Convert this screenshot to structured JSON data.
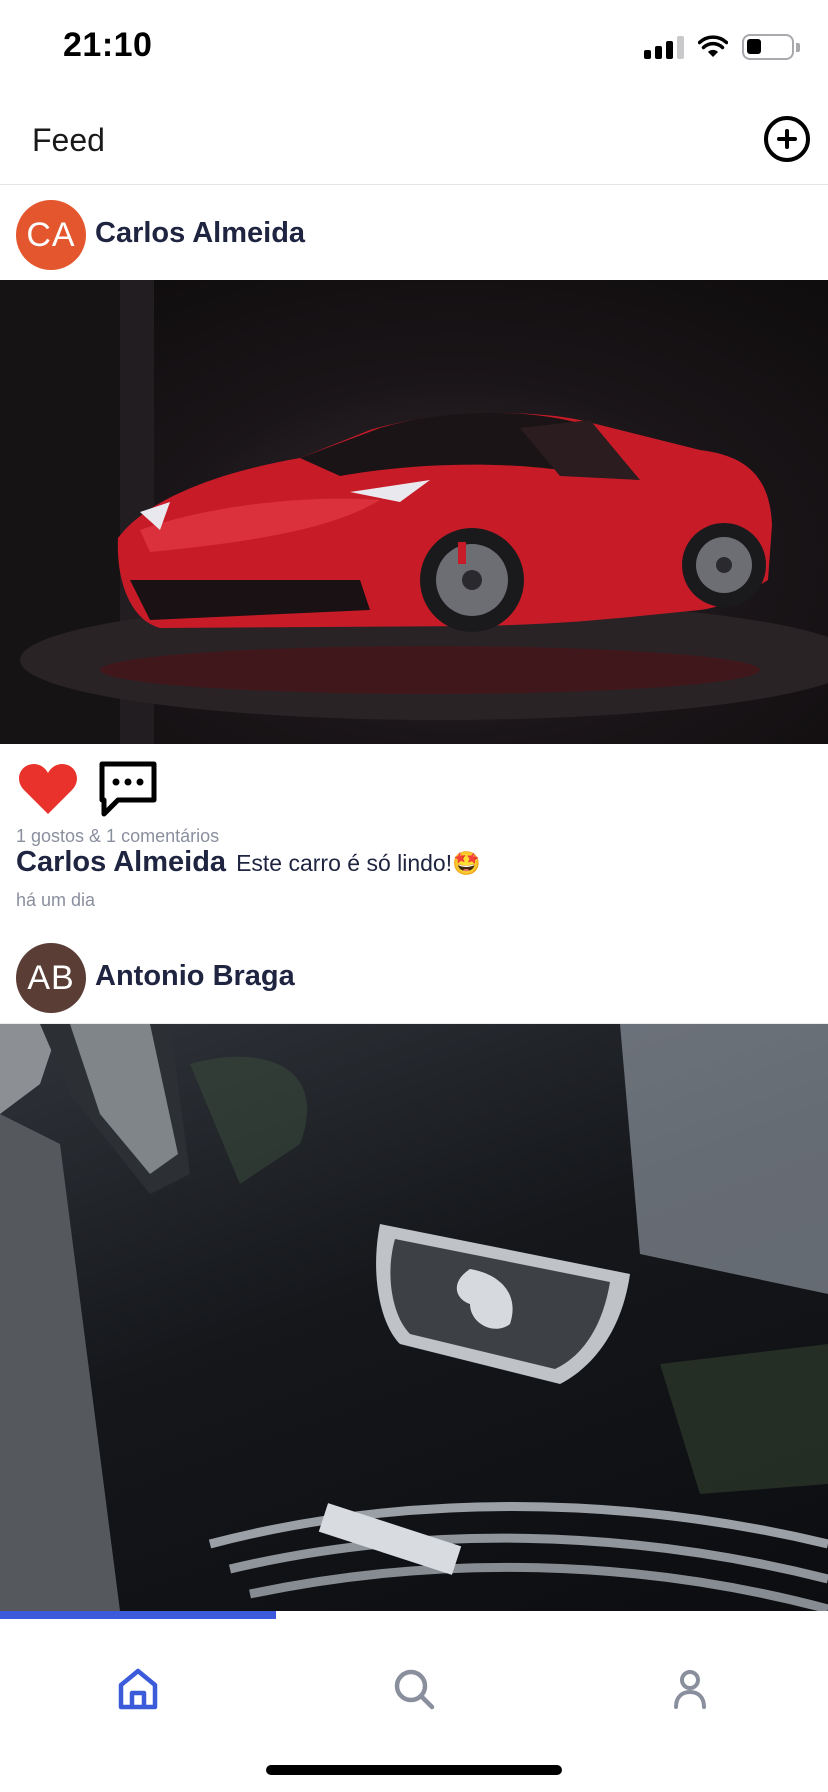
{
  "status_bar": {
    "time": "21:10"
  },
  "header": {
    "title": "Feed",
    "add_icon": "plus-circle-icon"
  },
  "posts": [
    {
      "author": "Carlos Almeida",
      "initials": "CA",
      "avatar_color": "#e4572e",
      "image_description": "red sports car",
      "liked": true,
      "likes_summary": "1 gostos & 1 comentários",
      "caption_author": "Carlos Almeida",
      "caption_text": "Este carro é só lindo!🤩",
      "time_ago": "há um dia"
    },
    {
      "author": "Antonio Braga",
      "initials": "AB",
      "avatar_color": "#5a3d34"
    }
  ],
  "feed_progress": 0.333,
  "tab_bar": {
    "active": "home",
    "tabs": [
      {
        "name": "home",
        "icon": "home-icon",
        "color": "#3b5bdb"
      },
      {
        "name": "search",
        "icon": "search-icon",
        "color": "#8a8f9e"
      },
      {
        "name": "profile",
        "icon": "user-icon",
        "color": "#8a8f9e"
      }
    ]
  }
}
